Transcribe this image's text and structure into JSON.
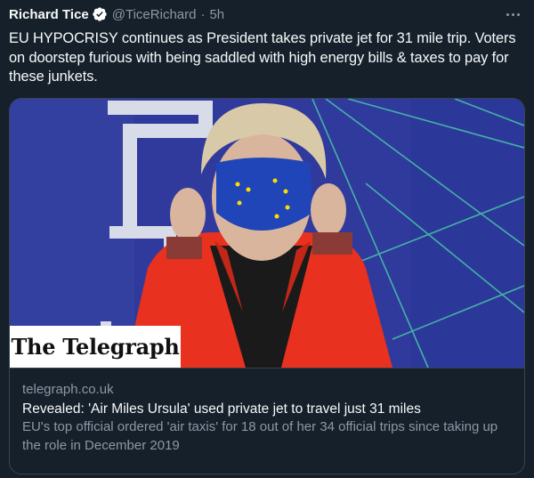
{
  "tweet": {
    "author_name": "Richard Tice",
    "author_handle": "@TiceRichard",
    "separator": "·",
    "timestamp": "5h",
    "text": "EU HYPOCRISY continues as President takes private jet for 31 mile trip. Voters on doorstep furious with being saddled with high energy bills & taxes to pay for these junkets."
  },
  "card": {
    "publisher_logo_text": "The Telegraph",
    "domain": "telegraph.co.uk",
    "title": "Revealed: 'Air Miles Ursula' used private jet to travel just 31 miles",
    "description": "EU's top official ordered 'air taxis' for 18 out of her 34 official trips since taking up the role in December 2019"
  },
  "colors": {
    "background": "#15202b",
    "text_primary": "#f7f9f9",
    "text_secondary": "#8b98a5",
    "border": "#38444d",
    "verified_badge": "#ffffff",
    "photo_backdrop": "#2f3a9c",
    "jacket": "#e8311f",
    "mask": "#1f45b8"
  },
  "icons": {
    "verified": "verified-badge-icon",
    "more": "more-options-icon"
  }
}
